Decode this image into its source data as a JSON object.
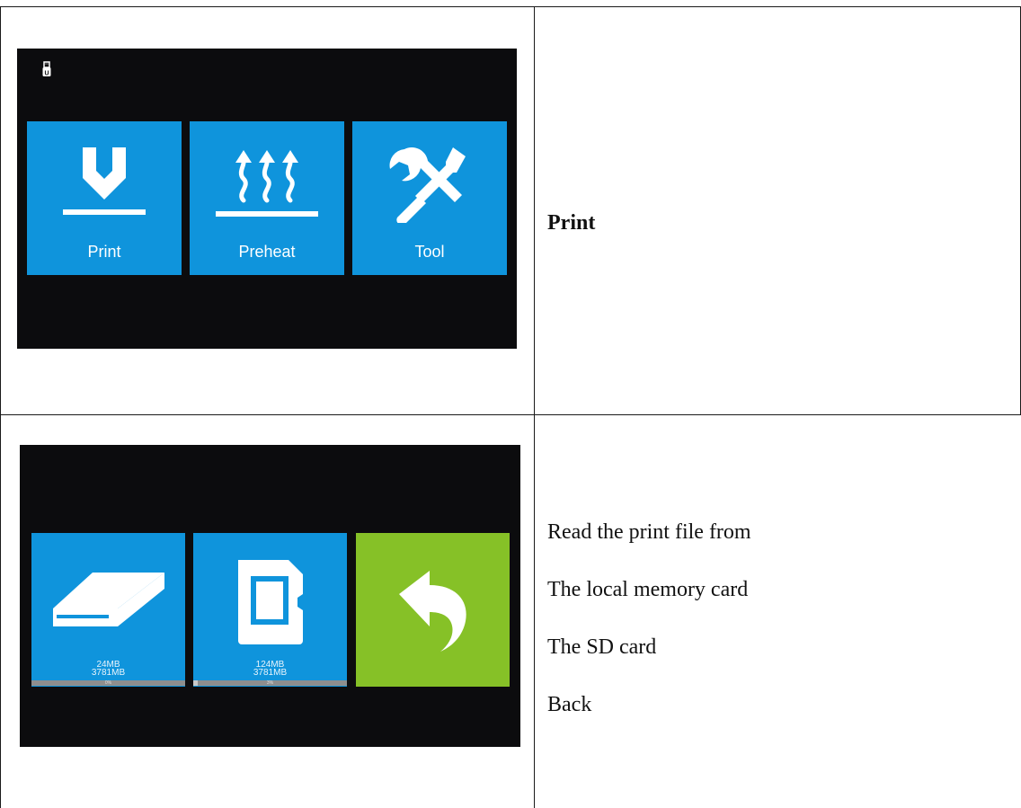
{
  "rows": [
    {
      "screen": {
        "status_icon": "usb-drive-icon",
        "tiles": [
          {
            "label": "Print",
            "icon": "print-nozzle-icon",
            "color": "#0f94dc"
          },
          {
            "label": "Preheat",
            "icon": "heat-waves-icon",
            "color": "#0f94dc"
          },
          {
            "label": "Tool",
            "icon": "wrench-screwdriver-icon",
            "color": "#0f94dc"
          }
        ]
      },
      "description": {
        "title": "Print"
      }
    },
    {
      "screen": {
        "tiles": [
          {
            "icon": "local-storage-icon",
            "used": "24MB",
            "total": "3781MB",
            "progress_text": "0%",
            "progress": 0,
            "color": "#0f94dc"
          },
          {
            "icon": "sd-card-icon",
            "used": "124MB",
            "total": "3781MB",
            "progress_text": "3%",
            "progress": 3,
            "color": "#0f94dc"
          },
          {
            "icon": "back-arrow-icon",
            "color": "#86c127"
          }
        ]
      },
      "description": {
        "lines": [
          "Read the print file from",
          "The local memory card",
          "The SD card",
          "Back"
        ]
      }
    }
  ],
  "colors": {
    "screen_bg": "#0c0c0e",
    "tile_blue": "#0f94dc",
    "tile_green": "#86c127"
  }
}
